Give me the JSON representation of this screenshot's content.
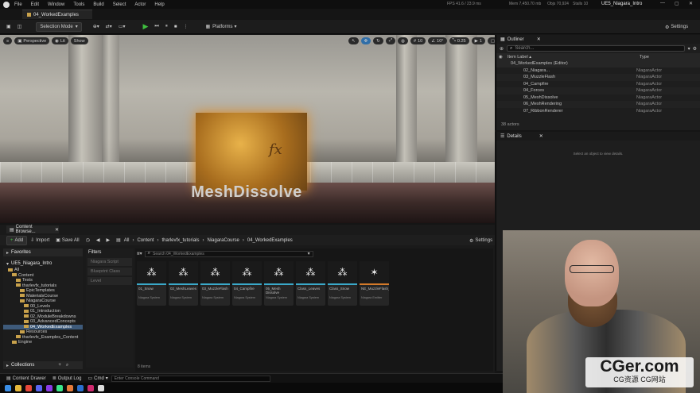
{
  "window": {
    "menu": [
      "File",
      "Edit",
      "Window",
      "Tools",
      "Build",
      "Select",
      "Actor",
      "Help"
    ],
    "project": "UE5_Niagara_Intro",
    "stats": {
      "fps": "FPS 41.6 / 23.9 ms",
      "mem": "Mem 7,450.70 mb",
      "objs": "Objs 70,924",
      "stalls": "Stalls 10"
    },
    "doc_tab": "04_WorkedExamples"
  },
  "toolbar": {
    "selection_mode": "Selection Mode",
    "platforms": "Platforms",
    "settings": "Settings"
  },
  "viewport": {
    "perspective": "Perspective",
    "lit": "Lit",
    "show": "Show",
    "snap_grid": "10",
    "snap_rot": "10°",
    "snap_scale": "0.25",
    "cam_speed": "1",
    "overlay_text": "MeshDissolve",
    "mesh_text": "fx"
  },
  "outliner": {
    "tab": "Outliner",
    "search_placeholder": "Search...",
    "col_label": "Item Label",
    "col_type": "Type",
    "root": "04_WorkedExamples (Editor)",
    "rows": [
      {
        "name": "02_Niagara...",
        "type": "NiagaraActor"
      },
      {
        "name": "03_MuzzleFlash",
        "type": "NiagaraActor"
      },
      {
        "name": "04_Campfire",
        "type": "NiagaraActor"
      },
      {
        "name": "04_Forces",
        "type": "NiagaraActor"
      },
      {
        "name": "05_MeshDissolve",
        "type": "NiagaraActor"
      },
      {
        "name": "06_MeshRendering",
        "type": "NiagaraActor"
      },
      {
        "name": "07_RibbonRenderer",
        "type": "NiagaraActor"
      }
    ],
    "count": "38 actors"
  },
  "details": {
    "tab": "Details",
    "empty": "Select an object to view details."
  },
  "content_browser": {
    "tab": "Content Browse...",
    "add": "Add",
    "import": "Import",
    "save_all": "Save All",
    "path": [
      "All",
      "Content",
      "tharlevfx_tutorials",
      "NiagaraCourse",
      "04_WorkedExamples"
    ],
    "settings": "Settings",
    "favorites": "Favorites",
    "project_root": "UE5_Niagara_Intro",
    "tree": [
      {
        "label": "All",
        "depth": 0,
        "sel": false
      },
      {
        "label": "Content",
        "depth": 1,
        "sel": false
      },
      {
        "label": "Tests",
        "depth": 2,
        "sel": false
      },
      {
        "label": "tharlevfx_tutorials",
        "depth": 2,
        "sel": false
      },
      {
        "label": "EpicTemplates",
        "depth": 3,
        "sel": false
      },
      {
        "label": "MaterialsCourse",
        "depth": 3,
        "sel": false
      },
      {
        "label": "NiagaraCourse",
        "depth": 3,
        "sel": false
      },
      {
        "label": "00_Levels",
        "depth": 4,
        "sel": false
      },
      {
        "label": "01_Introduction",
        "depth": 4,
        "sel": false
      },
      {
        "label": "02_ModuleBreakdowns",
        "depth": 4,
        "sel": false
      },
      {
        "label": "03_AdvancedConcepts",
        "depth": 4,
        "sel": false
      },
      {
        "label": "04_WorkedExamples",
        "depth": 4,
        "sel": true
      },
      {
        "label": "Resources",
        "depth": 3,
        "sel": false
      },
      {
        "label": "tharlevfx_Examples_Content",
        "depth": 2,
        "sel": false
      },
      {
        "label": "Engine",
        "depth": 1,
        "sel": false
      }
    ],
    "collections": "Collections",
    "filters_title": "Filters",
    "filters": [
      "Niagara Script",
      "Blueprint Class",
      "Level"
    ],
    "search_placeholder": "Search 04_WorkedExamples",
    "assets": [
      {
        "label": "01_Snow",
        "type": "Niagara System",
        "kind": "sys"
      },
      {
        "label": "02_MeshLeaves",
        "type": "Niagara System",
        "kind": "sys"
      },
      {
        "label": "03_MuzzleFlash",
        "type": "Niagara System",
        "kind": "sys"
      },
      {
        "label": "04_Campfire",
        "type": "Niagara System",
        "kind": "sys"
      },
      {
        "label": "05_Mesh Dissolve",
        "type": "Niagara System",
        "kind": "sys"
      },
      {
        "label": "Class_Leaves",
        "type": "Niagara System",
        "kind": "sys"
      },
      {
        "label": "Class_Snow",
        "type": "Niagara System",
        "kind": "sys"
      },
      {
        "label": "NE_MuzzleFlash_Emitter",
        "type": "Niagara Emitter",
        "kind": "em"
      }
    ],
    "item_count": "8 items"
  },
  "status": {
    "drawer": "Content Drawer",
    "output": "Output Log",
    "cmd": "Cmd",
    "console_placeholder": "Enter Console Command"
  },
  "watermark": {
    "big": "CGer.com",
    "small": "CG资源 CG网站"
  },
  "colors": {
    "accent_blue": "#3aa9c9",
    "emitter_orange": "#d47a2a",
    "selection": "#3e5a7a",
    "play_green": "#3fbf3f"
  }
}
